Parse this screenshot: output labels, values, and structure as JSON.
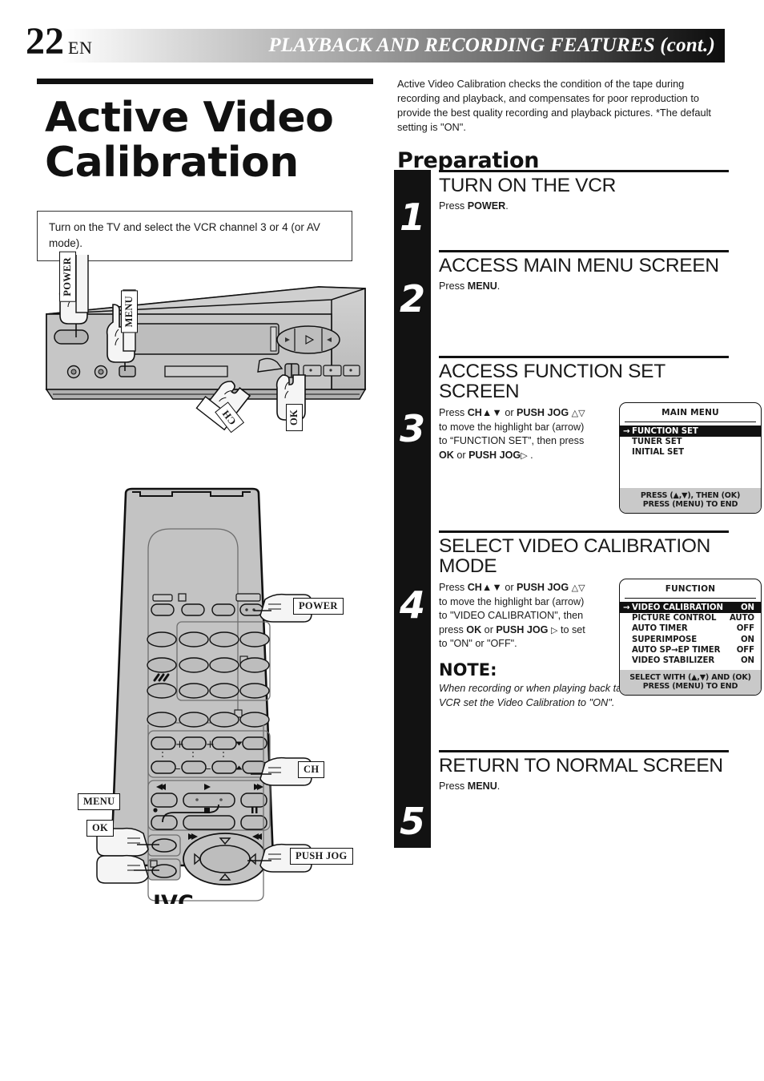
{
  "header": {
    "page_number": "22",
    "language": "EN",
    "title": "PLAYBACK AND RECORDING FEATURES (cont.)"
  },
  "left": {
    "main_title_line1": "Active Video",
    "main_title_line2": "Calibration",
    "prep_box": "Turn on the TV and select the VCR channel 3 or 4 (or AV mode)."
  },
  "right": {
    "intro": "Active Video Calibration checks the condition of the tape during recording and playback, and compensates for poor reproduction to provide the best quality recording and playback pictures. *The default setting is \"ON\".",
    "preparation_heading": "Preparation"
  },
  "steps": [
    {
      "number": "1",
      "title": "TURN ON THE VCR",
      "body_plain": "Press POWER.",
      "body_html": "Press <b>POWER</b>."
    },
    {
      "number": "2",
      "title": "ACCESS MAIN MENU SCREEN",
      "body_plain": "Press MENU.",
      "body_html": "Press <b>MENU</b>."
    },
    {
      "number": "3",
      "title": "ACCESS FUNCTION SET SCREEN",
      "body_plain": "Press CH▲▼ or PUSH JOG △▽ to move the highlight bar (arrow) to “FUNCTION SET”, then press OK or PUSH JOG ▷ .",
      "body_html": "Press <b>CH▲▼</b> or <b>PUSH JOG</b> <span class=\"tri\">△▽</span> to move the highlight bar (arrow) to “FUNCTION SET”, then press <b>OK</b> or <b>PUSH JOG</b><span class=\"tri\">▷</span> ."
    },
    {
      "number": "4",
      "title": "SELECT VIDEO CALIBRATION MODE",
      "body_plain": "Press CH▲▼ or PUSH JOG △▽ to move the highlight bar (arrow) to \"VIDEO CALIBRATION\", then press OK or PUSH JOG ▷ to set to \"ON\" or \"OFF\".",
      "body_html": "Press <b>CH▲▼</b> or <b>PUSH JOG</b> <span class=\"tri\">△▽</span> to move the highlight bar (arrow) to \"VIDEO CALIBRATION\", then press <b>OK</b> or <b>PUSH JOG</b> <span class=\"tri\">▷</span> to set to \"ON\" or \"OFF\"."
    },
    {
      "number": "5",
      "title": "RETURN TO NORMAL SCREEN",
      "body_plain": "Press MENU.",
      "body_html": "Press <b>MENU</b>."
    }
  ],
  "note": {
    "heading": "NOTE:",
    "body": "When recording or when playing back tapes recorded on this VCR set the Video Calibration to \"ON\"."
  },
  "osd_main_menu": {
    "title": "MAIN MENU",
    "rows": [
      {
        "label": "FUNCTION SET",
        "value": "",
        "selected": true
      },
      {
        "label": "TUNER SET",
        "value": "",
        "selected": false
      },
      {
        "label": "INITIAL SET",
        "value": "",
        "selected": false
      }
    ],
    "footer": [
      "PRESS (▲,▼), THEN (OK)",
      "PRESS (MENU) TO END"
    ]
  },
  "osd_function": {
    "title": "FUNCTION",
    "rows": [
      {
        "label": "VIDEO CALIBRATION",
        "value": "ON",
        "selected": true
      },
      {
        "label": "PICTURE CONTROL",
        "value": "AUTO",
        "selected": false
      },
      {
        "label": "AUTO TIMER",
        "value": "OFF",
        "selected": false
      },
      {
        "label": "SUPERIMPOSE",
        "value": "ON",
        "selected": false
      },
      {
        "label": "AUTO SP→EP TIMER",
        "value": "OFF",
        "selected": false
      },
      {
        "label": "VIDEO STABILIZER",
        "value": "ON",
        "selected": false
      }
    ],
    "footer": [
      "SELECT WITH (▲,▼) AND (OK)",
      "PRESS (MENU) TO END"
    ]
  },
  "vcr_diagram": {
    "callouts": [
      "POWER",
      "MENU",
      "CH",
      "OK"
    ]
  },
  "remote_diagram": {
    "brand": "JVC",
    "callouts": [
      "POWER",
      "CH",
      "MENU",
      "OK",
      "PUSH JOG"
    ]
  },
  "colors": {
    "ink": "#111111",
    "osd_footer_gray": "#c9c9c9",
    "device_gray": "#c3c3c3"
  }
}
